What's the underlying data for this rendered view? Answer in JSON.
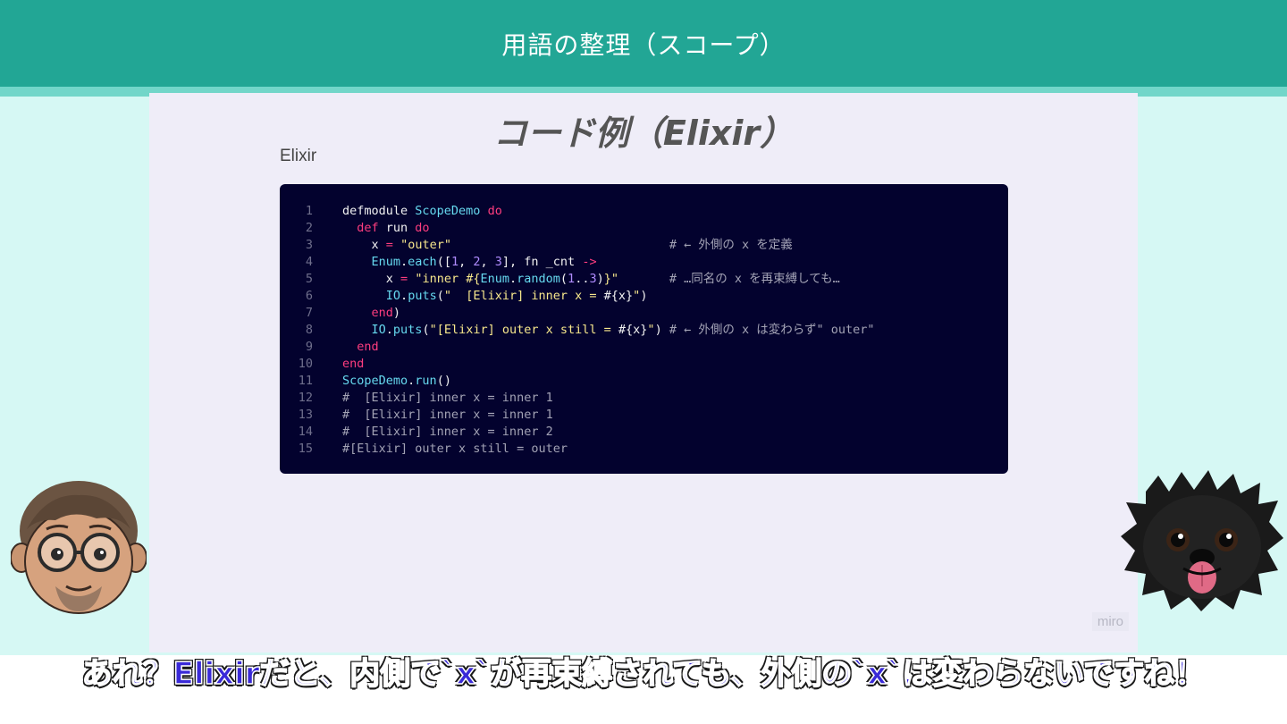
{
  "header": {
    "title": "用語の整理（スコープ）"
  },
  "slide": {
    "title": "コード例（Elixir）",
    "lang_label": "Elixir",
    "watermark": "miro"
  },
  "code": {
    "line_numbers": [
      "1",
      "2",
      "3",
      "4",
      "5",
      "6",
      "7",
      "8",
      "9",
      "10",
      "11",
      "12",
      "13",
      "14",
      "15"
    ]
  },
  "subtitle": {
    "text": "あれ？Elixirだと、内側で`x`が再束縛されても、外側の`x`は変わらないですね！"
  },
  "avatars": {
    "left": "person-avatar",
    "right": "dog-avatar"
  }
}
